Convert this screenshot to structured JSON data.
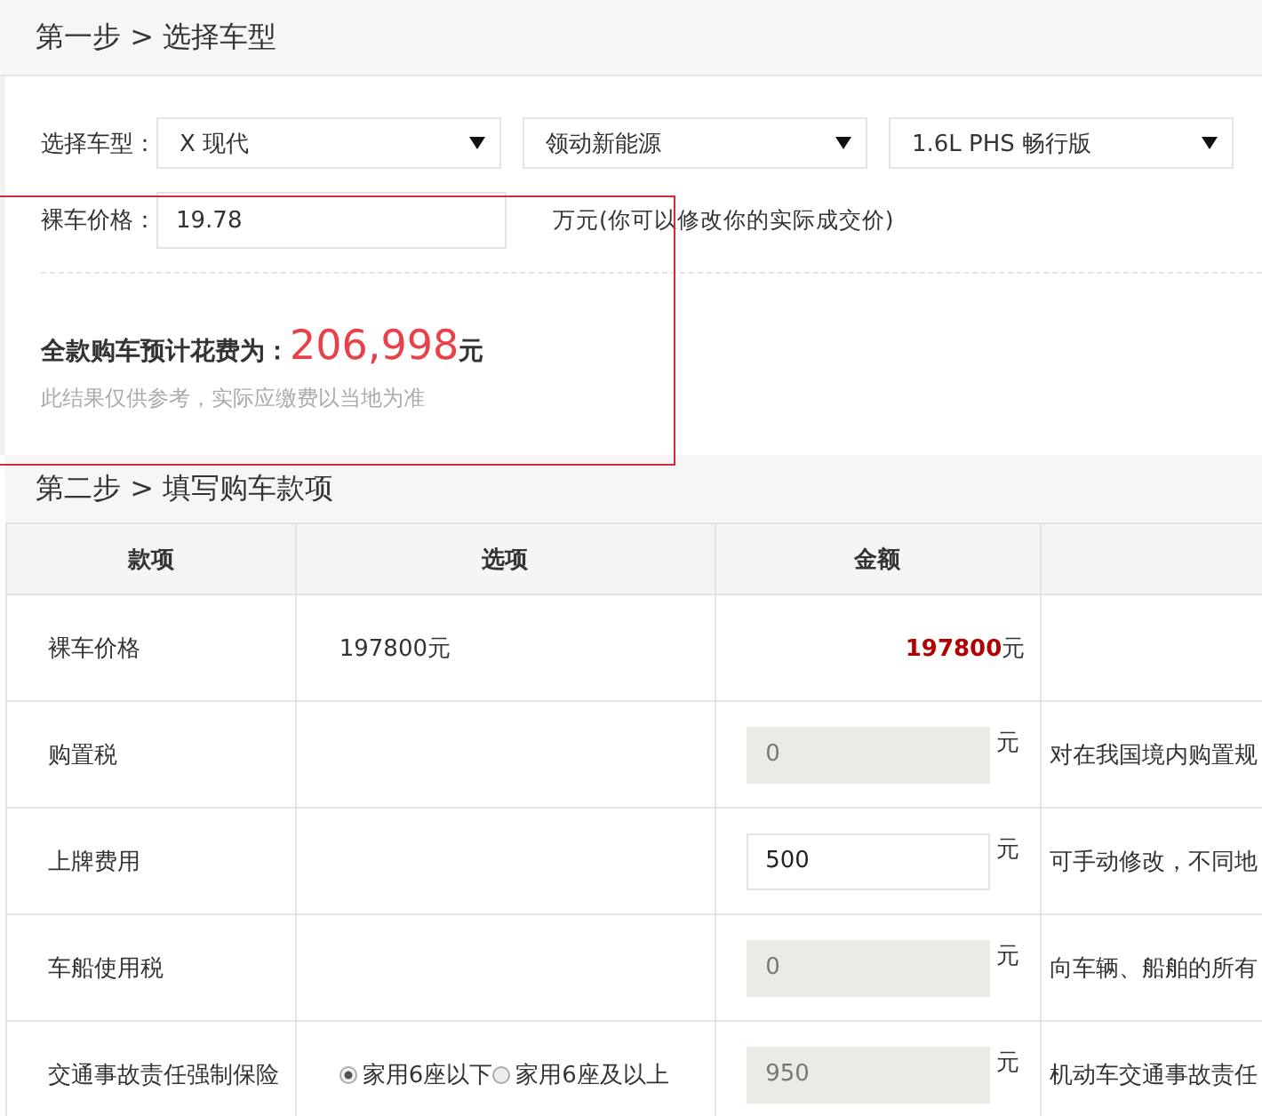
{
  "step1": {
    "title": "第一步 > 选择车型",
    "model_label": "选择车型：",
    "selects": [
      {
        "value": "X 现代"
      },
      {
        "value": "领动新能源"
      },
      {
        "value": "1.6L PHS 畅行版"
      }
    ],
    "price_label": "裸车价格：",
    "price_value": "19.78",
    "price_hint": "万元(你可以修改你的实际成交价)",
    "total_label": "全款购车预计花费为：",
    "total_value": "206,998",
    "total_unit": "元",
    "note": "此结果仅供参考，实际应缴费以当地为准"
  },
  "step2": {
    "title": "第二步 > 填写购车款项",
    "columns": [
      "款项",
      "选项",
      "金额"
    ],
    "rows": [
      {
        "kind": "price",
        "name": "裸车价格",
        "option": "197800元",
        "amount_text": "197800",
        "unit": "元"
      },
      {
        "kind": "input",
        "name": "购置税",
        "amount": "0",
        "disabled": true,
        "unit": "元",
        "description": "对在我国境内购置规"
      },
      {
        "kind": "input",
        "name": "上牌费用",
        "amount": "500",
        "disabled": false,
        "unit": "元",
        "description": "可手动修改，不同地"
      },
      {
        "kind": "input",
        "name": "车船使用税",
        "amount": "0",
        "disabled": true,
        "unit": "元",
        "description": "向车辆、船舶的所有"
      },
      {
        "kind": "input",
        "name": "交通事故责任强制保险",
        "radios": [
          {
            "label": "家用6座以下",
            "selected": true
          },
          {
            "label": "家用6座及以上",
            "selected": false
          }
        ],
        "amount": "950",
        "disabled": true,
        "unit": "元",
        "description": "机动车交通事故责任"
      }
    ]
  }
}
